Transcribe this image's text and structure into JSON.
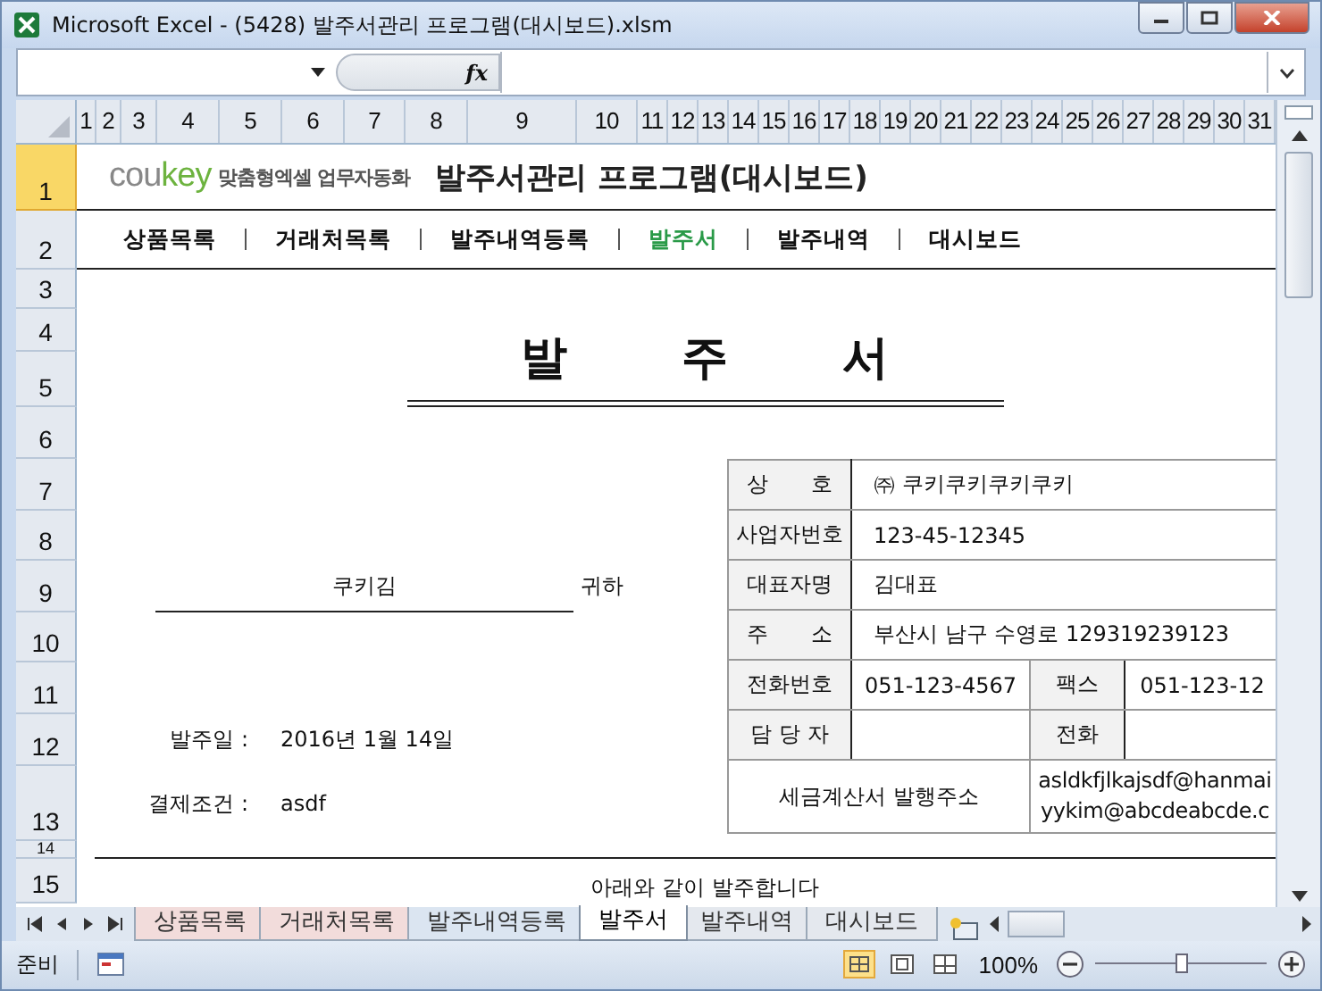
{
  "window": {
    "title": "Microsoft Excel - (5428) 발주서관리 프로그램(대시보드).xlsm"
  },
  "formula_bar": {
    "function_label": "fx"
  },
  "column_headers": [
    "1",
    "2",
    "3",
    "4",
    "5",
    "6",
    "7",
    "8",
    "9",
    "10",
    "11",
    "12",
    "13",
    "14",
    "15",
    "16",
    "17",
    "18",
    "19",
    "20",
    "21",
    "22",
    "23",
    "24",
    "25",
    "26",
    "27",
    "28",
    "29",
    "30",
    "31"
  ],
  "row_headers": [
    {
      "label": "1",
      "selected": true
    },
    {
      "label": "2",
      "selected": false
    },
    {
      "label": "3",
      "selected": false
    },
    {
      "label": "4",
      "selected": false
    },
    {
      "label": "5",
      "selected": false
    },
    {
      "label": "6",
      "selected": false
    },
    {
      "label": "7",
      "selected": false
    },
    {
      "label": "8",
      "selected": false
    },
    {
      "label": "9",
      "selected": false
    },
    {
      "label": "10",
      "selected": false
    },
    {
      "label": "11",
      "selected": false
    },
    {
      "label": "12",
      "selected": false
    },
    {
      "label": "13",
      "selected": false
    },
    {
      "label": "14",
      "selected": false
    },
    {
      "label": "15",
      "selected": false
    }
  ],
  "sheet": {
    "logo": [
      "cou",
      "key"
    ],
    "tagline": "맞춤형엑셀 업무자동화",
    "title": "발주서관리 프로그램(대시보드)",
    "nav": [
      {
        "label": "상품목록",
        "selected": false
      },
      {
        "label": "거래처목록",
        "selected": false
      },
      {
        "label": "발주내역등록",
        "selected": false
      },
      {
        "label": "발주서",
        "selected": true
      },
      {
        "label": "발주내역",
        "selected": false
      },
      {
        "label": "대시보드",
        "selected": false
      }
    ],
    "doc_title": [
      "발",
      "주",
      "서"
    ],
    "recipient": {
      "name": "쿠키김",
      "suffix": "귀하"
    },
    "fields": [
      {
        "label": "발주일 :",
        "value": "2016년 1월 14일"
      },
      {
        "label": "결제조건 :",
        "value": "asdf"
      }
    ],
    "supplier": [
      {
        "label": "상　　호",
        "value": "㈜ 쿠키쿠키쿠키쿠키"
      },
      {
        "label": "사업자번호",
        "value": "123-45-12345"
      },
      {
        "label": "대표자명",
        "value": "김대표"
      },
      {
        "label": "주　　소",
        "value": "부산시 남구 수영로 129319239123"
      },
      {
        "label": "전화번호",
        "value": "051-123-4567",
        "label2": "팩스",
        "value2": "051-123-12"
      },
      {
        "label": "담 당 자",
        "label2": "전화"
      }
    ],
    "tax_invoice": {
      "label": "세금계산서 발행주소",
      "emails": [
        "asldkfjlkajsdf@hanmai",
        "yykim@abcdeabcde.c"
      ]
    },
    "note": "아래와 같이 발주합니다"
  },
  "sheet_tabs": [
    {
      "label": "상품목록",
      "selected": false,
      "color": "#f2dcdb"
    },
    {
      "label": "거래처목록",
      "selected": false,
      "color": "#f2dcdb"
    },
    {
      "label": "발주내역등록",
      "selected": false,
      "color": "#dbe5f1"
    },
    {
      "label": "발주서",
      "selected": true,
      "color": "#ffffff"
    },
    {
      "label": "발주내역",
      "selected": false,
      "color": "#e4e8ee"
    },
    {
      "label": "대시보드",
      "selected": false,
      "color": "#e4e8ee"
    }
  ],
  "status_bar": {
    "mode": "준비",
    "zoom": "100%",
    "zoom_slider": {
      "level": 0.5
    }
  }
}
